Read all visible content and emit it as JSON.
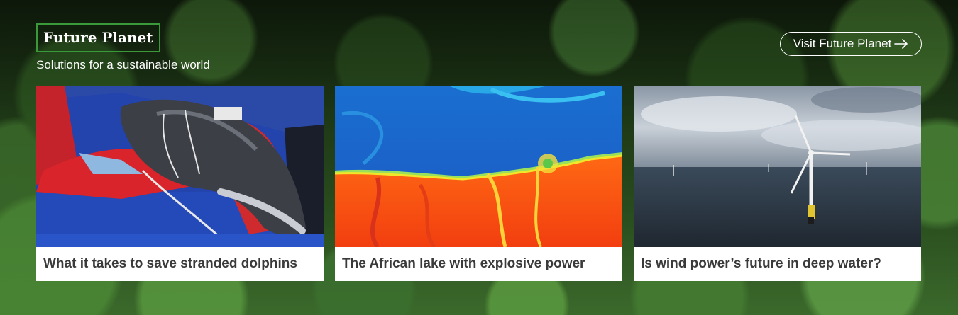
{
  "brand": {
    "title": "Future Planet",
    "tagline": "Solutions for a sustainable world"
  },
  "visit_button": {
    "label": "Visit Future Planet",
    "icon": "arrow-right-icon"
  },
  "cards": [
    {
      "title": "What it takes to save stranded dolphins",
      "image": "dolphin-photo"
    },
    {
      "title": "The African lake with explosive power",
      "image": "lake-fluid-illustration"
    },
    {
      "title": "Is wind power’s future in deep water?",
      "image": "offshore-wind-turbines-photo"
    }
  ],
  "colors": {
    "brand_border": "#3a9a3a",
    "card_title": "#3a3a3a",
    "text_on_bg": "#ffffff"
  }
}
